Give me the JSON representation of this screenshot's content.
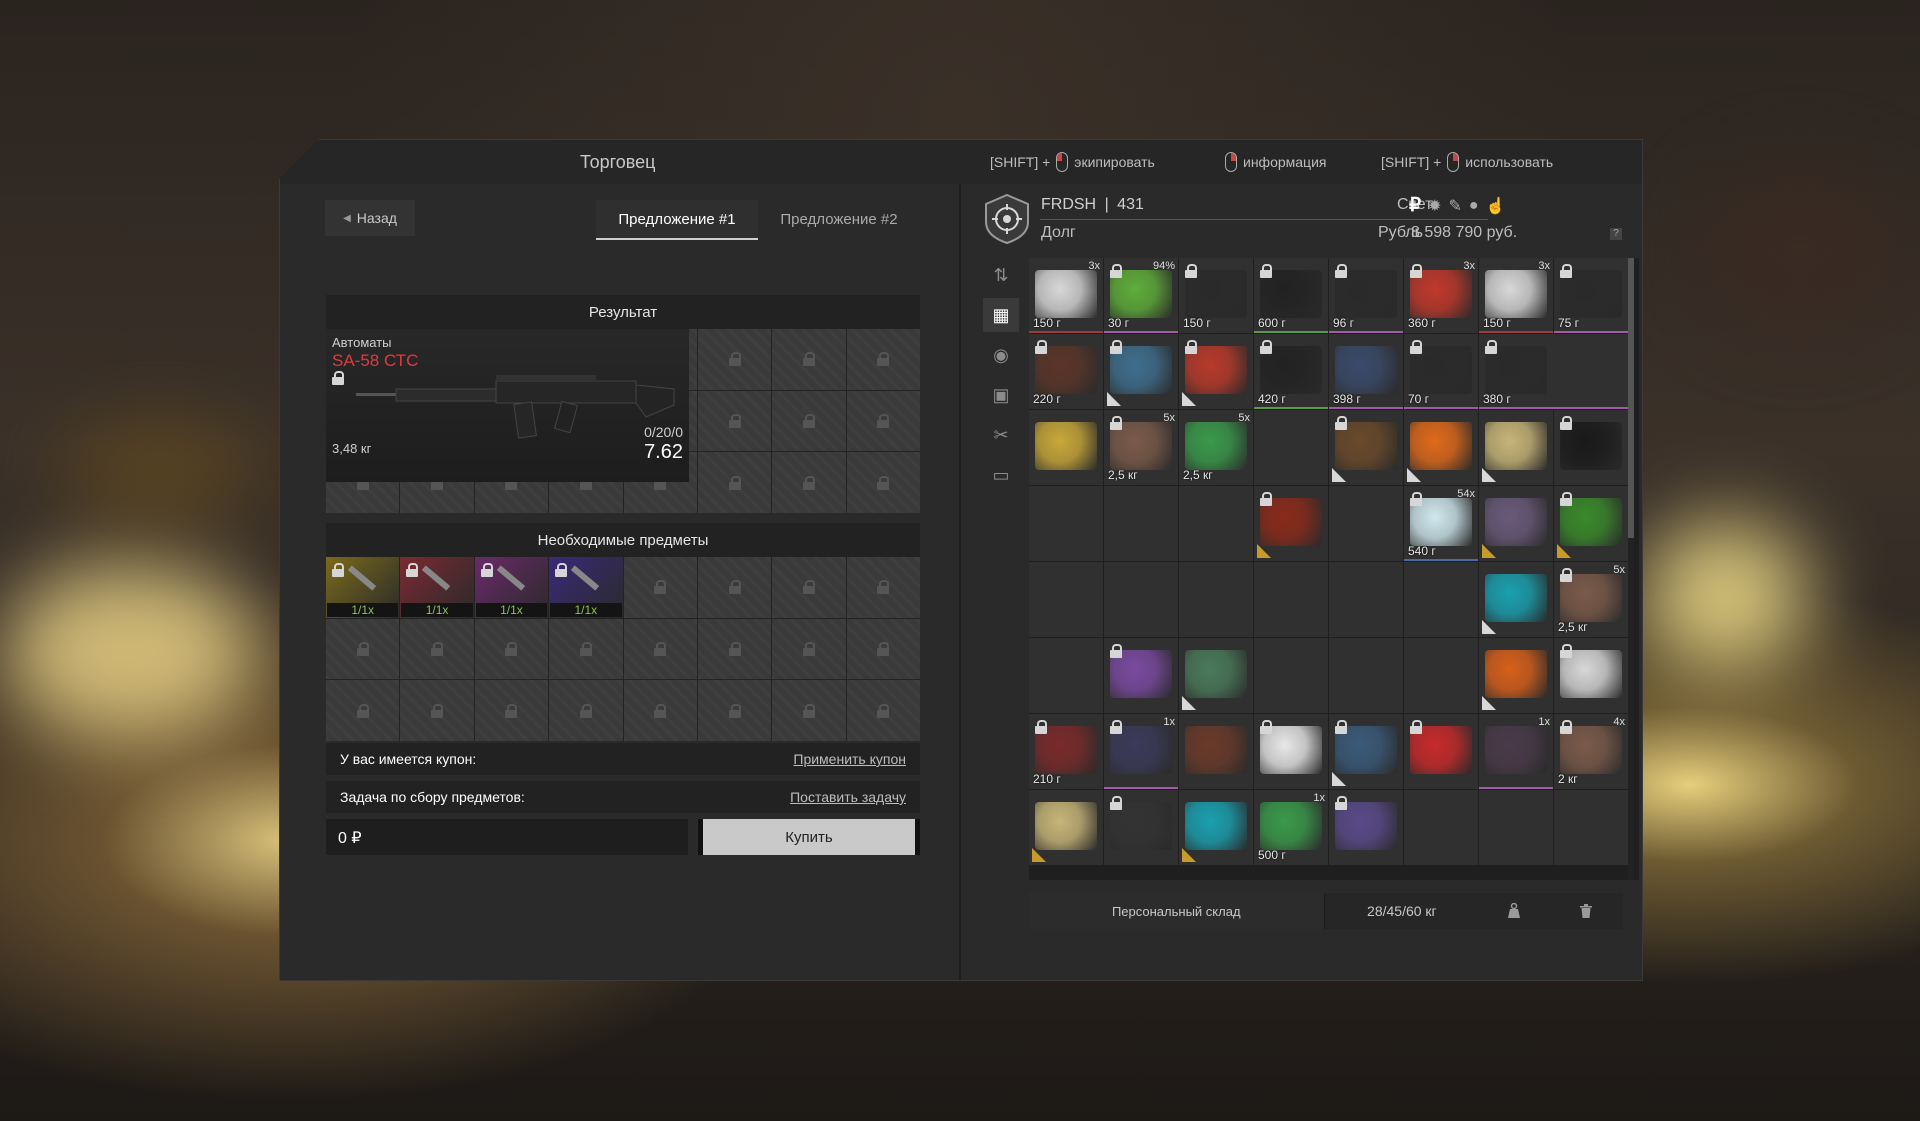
{
  "window": {
    "title": "Торговец"
  },
  "hints": [
    {
      "key": "[SHIFT] +",
      "action": "экипировать"
    },
    {
      "key": "",
      "action": "информация"
    },
    {
      "key": "[SHIFT] +",
      "action": "использовать"
    }
  ],
  "left": {
    "back_label": "Назад",
    "tabs": [
      {
        "label": "Предложение #1",
        "active": true
      },
      {
        "label": "Предложение #2",
        "active": false
      }
    ],
    "result_header": "Результат",
    "weapon": {
      "category": "Автоматы",
      "name": "SA-58 СТС",
      "weight": "3,48 кг",
      "ammo": "0/20/0",
      "caliber": "7.62"
    },
    "required_header": "Необходимые предметы",
    "required_items": [
      {
        "label": "1/1x",
        "color": "#7a6a1a"
      },
      {
        "label": "1/1x",
        "color": "#7a2a32"
      },
      {
        "label": "1/1x",
        "color": "#6a2a6a"
      },
      {
        "label": "1/1x",
        "color": "#3a2a7a"
      }
    ],
    "coupon": {
      "label": "У вас имеется купон:",
      "action": "Применить купон"
    },
    "task": {
      "label": "Задача по сбору предметов:",
      "action": "Поставить задачу"
    },
    "price": "0 ₽",
    "buy_label": "Купить"
  },
  "right": {
    "player": {
      "name": "FRDSH",
      "level": "431",
      "debt_label": "Долг"
    },
    "account_label": "Счет",
    "currency_label": "Рубль",
    "money": "8 598 790 руб.",
    "question": "?",
    "inventory": [
      {
        "cnt": "3x",
        "w": "150 г",
        "color": "#d8d8d8",
        "lock": false,
        "b": "bor-r"
      },
      {
        "cnt": "94%",
        "w": "30 г",
        "color": "#5fae3a",
        "lock": true,
        "b": "bor-p"
      },
      {
        "cnt": "",
        "w": "150 г",
        "color": "#2a2a2a",
        "lock": true,
        "b": ""
      },
      {
        "cnt": "",
        "w": "600 г",
        "color": "#222222",
        "lock": true,
        "b": "bor-g"
      },
      {
        "cnt": "",
        "w": "96 г",
        "color": "#2a2a2a",
        "lock": true,
        "b": "bor-p"
      },
      {
        "cnt": "3x",
        "w": "360 г",
        "color": "#c0382b",
        "lock": true,
        "b": ""
      },
      {
        "cnt": "3x",
        "w": "150 г",
        "color": "#d8d8d8",
        "lock": false,
        "b": "bor-r"
      },
      {
        "cnt": "",
        "w": "75 г",
        "color": "#2a2a2a",
        "lock": true,
        "b": "bor-p"
      },
      {
        "cnt": "",
        "w": "220 г",
        "color": "#5a3528",
        "lock": true,
        "b": ""
      },
      {
        "cnt": "",
        "w": "",
        "color": "#3f6e8e",
        "lock": true,
        "b": "",
        "corner": "w2"
      },
      {
        "cnt": "",
        "w": "",
        "color": "#b83a2a",
        "lock": true,
        "b": "",
        "corner": "w2"
      },
      {
        "cnt": "",
        "w": "420 г",
        "color": "#222222",
        "lock": true,
        "b": "bor-g"
      },
      {
        "cnt": "",
        "w": "398 г",
        "color": "#3a4a6a",
        "lock": false,
        "b": "bor-p"
      },
      {
        "cnt": "",
        "w": "70 г",
        "color": "#2a2a2a",
        "lock": true,
        "b": "bor-p"
      },
      {
        "cnt": "",
        "w": "380 г",
        "color": "#2a2a2a",
        "lock": true,
        "b": "bor-p",
        "span": 2
      },
      {
        "cnt": "",
        "w": "",
        "color": "#c9a83a",
        "lock": false,
        "b": ""
      },
      {
        "cnt": "5x",
        "w": "2,5 кг",
        "color": "#7a5a4a",
        "lock": true,
        "b": ""
      },
      {
        "cnt": "5x",
        "w": "2,5 кг",
        "color": "#3a9a4a",
        "lock": false,
        "b": ""
      },
      {
        "cnt": "",
        "w": "",
        "color": "",
        "lock": false,
        "b": ""
      },
      {
        "cnt": "",
        "w": "",
        "color": "#6a4a2a",
        "lock": true,
        "b": "",
        "corner": "w2"
      },
      {
        "cnt": "",
        "w": "",
        "color": "#e06a1a",
        "lock": false,
        "b": "",
        "corner": "w2"
      },
      {
        "cnt": "",
        "w": "",
        "color": "#c8b678",
        "lock": false,
        "b": "",
        "corner": "w2"
      },
      {
        "cnt": "",
        "w": "",
        "color": "#1a1a1a",
        "lock": true,
        "b": ""
      },
      {
        "cnt": "",
        "w": "",
        "color": "",
        "lock": false,
        "b": ""
      },
      {
        "cnt": "",
        "w": "",
        "color": "",
        "lock": false,
        "b": ""
      },
      {
        "cnt": "",
        "w": "",
        "color": "",
        "lock": false,
        "b": ""
      },
      {
        "cnt": "",
        "w": "",
        "color": "#8a2a1a",
        "lock": true,
        "b": "",
        "corner": "y"
      },
      {
        "cnt": "",
        "w": "",
        "color": "",
        "lock": false,
        "b": ""
      },
      {
        "cnt": "54x",
        "w": "540 г",
        "color": "#cfe8ee",
        "lock": true,
        "b": "bor-b"
      },
      {
        "cnt": "",
        "w": "",
        "color": "#6a5a7a",
        "lock": false,
        "b": "",
        "corner": "y"
      },
      {
        "cnt": "",
        "w": "",
        "color": "#3a8a2a",
        "lock": true,
        "b": "",
        "corner": "y"
      },
      {
        "cnt": "",
        "w": "",
        "color": "",
        "lock": false,
        "b": ""
      },
      {
        "cnt": "",
        "w": "",
        "color": "",
        "lock": false,
        "b": ""
      },
      {
        "cnt": "",
        "w": "",
        "color": "",
        "lock": false,
        "b": ""
      },
      {
        "cnt": "",
        "w": "",
        "color": "",
        "lock": false,
        "b": ""
      },
      {
        "cnt": "",
        "w": "",
        "color": "",
        "lock": false,
        "b": ""
      },
      {
        "cnt": "",
        "w": "",
        "color": "",
        "lock": false,
        "b": ""
      },
      {
        "cnt": "",
        "w": "",
        "color": "#1aa0b0",
        "lock": false,
        "b": "",
        "corner": "w2"
      },
      {
        "cnt": "5x",
        "w": "2,5 кг",
        "color": "#7a5a4a",
        "lock": true,
        "b": ""
      },
      {
        "cnt": "",
        "w": "",
        "color": "",
        "lock": false,
        "b": ""
      },
      {
        "cnt": "",
        "w": "",
        "color": "#7a4aa0",
        "lock": true,
        "b": ""
      },
      {
        "cnt": "",
        "w": "",
        "color": "#4a7a5a",
        "lock": false,
        "b": "",
        "corner": "w2"
      },
      {
        "cnt": "",
        "w": "",
        "color": "",
        "lock": false,
        "b": ""
      },
      {
        "cnt": "",
        "w": "",
        "color": "",
        "lock": false,
        "b": ""
      },
      {
        "cnt": "",
        "w": "",
        "color": "",
        "lock": false,
        "b": ""
      },
      {
        "cnt": "",
        "w": "",
        "color": "#d8601a",
        "lock": false,
        "b": "",
        "corner": "w2"
      },
      {
        "cnt": "",
        "w": "",
        "color": "#d8d8d8",
        "lock": true,
        "b": ""
      },
      {
        "cnt": "",
        "w": "210 г",
        "color": "#7a2a2a",
        "lock": true,
        "b": ""
      },
      {
        "cnt": "1x",
        "w": "",
        "color": "#3a3a5a",
        "lock": true,
        "b": "bor-p"
      },
      {
        "cnt": "",
        "w": "",
        "color": "#6a3a2a",
        "lock": false,
        "b": ""
      },
      {
        "cnt": "",
        "w": "",
        "color": "#e8e8e8",
        "lock": true,
        "b": ""
      },
      {
        "cnt": "",
        "w": "",
        "color": "#3a5a7a",
        "lock": true,
        "b": "",
        "corner": "w2"
      },
      {
        "cnt": "",
        "w": "",
        "color": "#c82a2a",
        "lock": true,
        "b": ""
      },
      {
        "cnt": "1x",
        "w": "",
        "color": "#4a3a4a",
        "lock": false,
        "b": "bor-p"
      },
      {
        "cnt": "4x",
        "w": "2 кг",
        "color": "#7a5a4a",
        "lock": true,
        "b": ""
      },
      {
        "cnt": "",
        "w": "",
        "color": "#c8b678",
        "lock": false,
        "b": "",
        "corner": "y"
      },
      {
        "cnt": "",
        "w": "",
        "color": "#333333",
        "lock": true,
        "b": ""
      },
      {
        "cnt": "",
        "w": "",
        "color": "#1aa0b0",
        "lock": false,
        "b": "",
        "corner": "y"
      },
      {
        "cnt": "1x",
        "w": "500 г",
        "color": "#3a9a4a",
        "lock": false,
        "b": ""
      },
      {
        "cnt": "",
        "w": "",
        "color": "#5a4a8a",
        "lock": true,
        "b": ""
      },
      {
        "cnt": "",
        "w": "",
        "color": "",
        "lock": false,
        "b": ""
      },
      {
        "cnt": "",
        "w": "",
        "color": "",
        "lock": false,
        "b": ""
      },
      {
        "cnt": "",
        "w": "",
        "color": "",
        "lock": false,
        "b": ""
      }
    ],
    "storage": {
      "label": "Персональный склад",
      "weight": "28/45/60 кг"
    }
  }
}
